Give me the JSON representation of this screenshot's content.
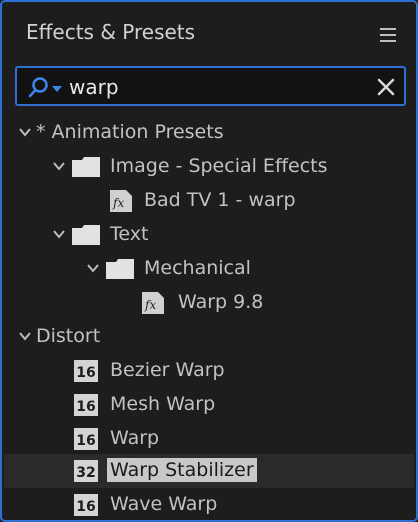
{
  "panel": {
    "title": "Effects & Presets"
  },
  "search": {
    "value": "warp"
  },
  "tree": {
    "presets_label": "* Animation Presets",
    "image_label": "Image - Special Effects",
    "bad_tv_label": "Bad TV 1 - warp",
    "text_label": "Text",
    "mechanical_label": "Mechanical",
    "warp98_label": "Warp 9.8",
    "distort_label": "Distort",
    "effects": [
      {
        "label": "Bezier Warp",
        "bits": "16"
      },
      {
        "label": "Mesh Warp",
        "bits": "16"
      },
      {
        "label": "Warp",
        "bits": "16"
      },
      {
        "label": "Warp Stabilizer",
        "bits": "32"
      },
      {
        "label": "Wave Warp",
        "bits": "16"
      }
    ]
  },
  "colors": {
    "accent": "#2f6fd0",
    "selection": "#c8c8c8"
  },
  "icons": [
    "menu-icon",
    "search-icon",
    "close-icon",
    "chevron-down-icon",
    "folder-icon",
    "fx-preset-icon",
    "bit-depth-icon"
  ]
}
